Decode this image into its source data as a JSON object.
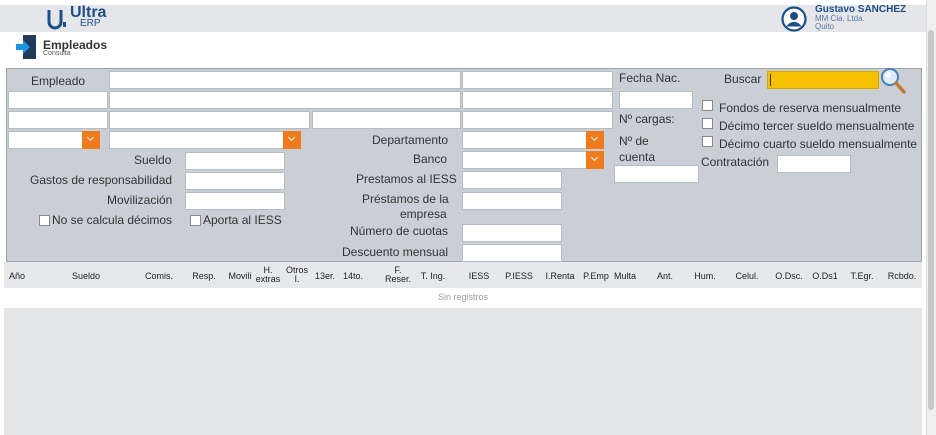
{
  "app": {
    "logo_top": "Ultra",
    "logo_bottom": "ERP"
  },
  "user": {
    "name": "Gustavo SANCHEZ",
    "company": "MM Cia. Ltda.",
    "city": "Quito"
  },
  "page": {
    "title": "Empleados",
    "subtitle": "Consulta"
  },
  "form": {
    "empleado_label": "Empleado",
    "fecha_nac_label": "Fecha Nac.",
    "buscar_label": "Buscar",
    "buscar_value": "",
    "cargas_label": "Nº cargas:",
    "cuenta_label_1": "Nº de",
    "cuenta_label_2": "cuenta",
    "departamento_label": "Departamento",
    "banco_label": "Banco",
    "sueldo_label": "Sueldo",
    "gastos_label": "Gastos de responsabilidad",
    "movilizacion_label": "Movilización",
    "prestamos_iess_label": "Prestamos al IESS",
    "prestamos_empresa_label_1": "Préstamos de la",
    "prestamos_empresa_label_2": "empresa",
    "numero_cuotas_label": "Número de cuotas",
    "descuento_label": "Descuento mensual",
    "no_decimos_label": "No se calcula décimos",
    "aporta_iess_label": "Aporta al IESS",
    "fondos_label": "Fondos de reserva mensualmente",
    "decimo_tercer_label": "Décimo tercer sueldo mensualmente",
    "decimo_cuarto_label": "Décimo cuarto sueldo mensualmente",
    "contratacion_label": "Contratación"
  },
  "grid": {
    "columns": [
      {
        "l1": "Año",
        "l2": ""
      },
      {
        "l1": "Sueldo",
        "l2": ""
      },
      {
        "l1": "Comis.",
        "l2": ""
      },
      {
        "l1": "Resp.",
        "l2": ""
      },
      {
        "l1": "Movili",
        "l2": ""
      },
      {
        "l1": "H.",
        "l2": "extras"
      },
      {
        "l1": "Otros",
        "l2": "I."
      },
      {
        "l1": "13er.",
        "l2": ""
      },
      {
        "l1": "14to.",
        "l2": ""
      },
      {
        "l1": "F.",
        "l2": "Reser."
      },
      {
        "l1": "T. Ing.",
        "l2": ""
      },
      {
        "l1": "IESS",
        "l2": ""
      },
      {
        "l1": "P.IESS",
        "l2": ""
      },
      {
        "l1": "I.Renta",
        "l2": ""
      },
      {
        "l1": "P.Emp",
        "l2": ""
      },
      {
        "l1": "Multa",
        "l2": ""
      },
      {
        "l1": "Ant.",
        "l2": ""
      },
      {
        "l1": "Hum.",
        "l2": ""
      },
      {
        "l1": "Celul.",
        "l2": ""
      },
      {
        "l1": "O.Dsc.",
        "l2": ""
      },
      {
        "l1": "O.Ds1",
        "l2": ""
      },
      {
        "l1": "T.Egr.",
        "l2": ""
      },
      {
        "l1": "Rcbdo.",
        "l2": ""
      }
    ],
    "empty_text": "Sin registros"
  },
  "colors": {
    "accent": "#ef7b1d",
    "brand": "#1d4f86",
    "search_field": "#f5c000",
    "panel": "#c9cfd4"
  }
}
